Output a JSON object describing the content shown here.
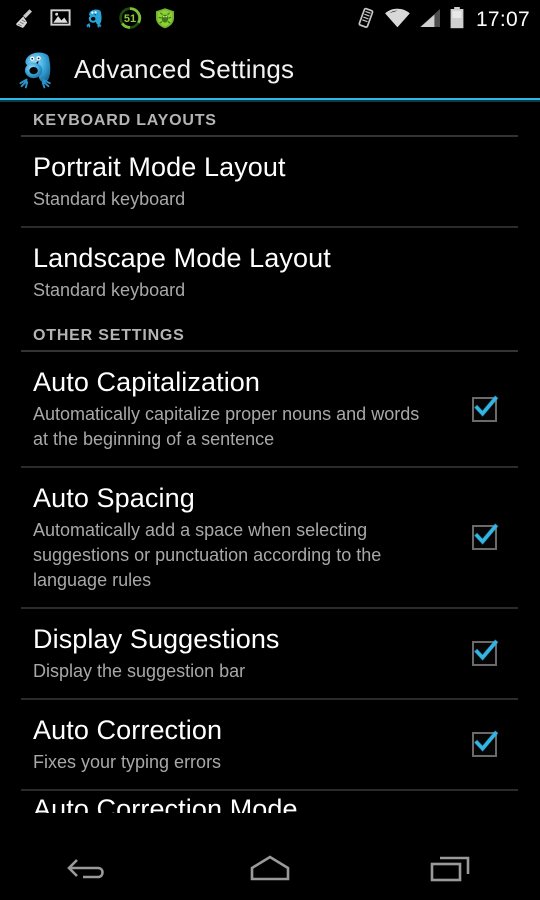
{
  "status_bar": {
    "left_icons": [
      {
        "name": "cleaner-broom-icon",
        "label": "Cleaner"
      },
      {
        "name": "gallery-image-icon",
        "label": "Gallery"
      },
      {
        "name": "adaptxt-keyboard-icon",
        "label": "Adaptxt Keyboard"
      },
      {
        "name": "battery-saver-progress-icon",
        "label": "Battery Saver",
        "value": "51"
      },
      {
        "name": "antivirus-shield-icon",
        "label": "Antivirus"
      }
    ],
    "right_icons": [
      {
        "name": "vibrate-icon",
        "label": "Vibrate"
      },
      {
        "name": "wifi-icon",
        "label": "Wi-Fi"
      },
      {
        "name": "cell-signal-icon",
        "label": "Mobile signal"
      },
      {
        "name": "battery-icon",
        "label": "Battery"
      }
    ],
    "clock": "17:07"
  },
  "action_bar": {
    "icon_name": "adaptxt-app-icon",
    "title": "Advanced Settings",
    "accent_color": "#33b5e5"
  },
  "sections": [
    {
      "header": "KEYBOARD LAYOUTS",
      "items": [
        {
          "name": "portrait-mode-layout",
          "title": "Portrait Mode Layout",
          "summary": "Standard keyboard",
          "has_checkbox": false
        },
        {
          "name": "landscape-mode-layout",
          "title": "Landscape Mode Layout",
          "summary": "Standard keyboard",
          "has_checkbox": false
        }
      ]
    },
    {
      "header": "OTHER SETTINGS",
      "items": [
        {
          "name": "auto-capitalization",
          "title": "Auto Capitalization",
          "summary": "Automatically capitalize proper nouns and words at the beginning of a sentence",
          "has_checkbox": true,
          "checked": true
        },
        {
          "name": "auto-spacing",
          "title": "Auto Spacing",
          "summary": "Automatically add a space when selecting suggestions or punctuation according to the language rules",
          "has_checkbox": true,
          "checked": true
        },
        {
          "name": "display-suggestions",
          "title": "Display Suggestions",
          "summary": "Display the suggestion bar",
          "has_checkbox": true,
          "checked": true
        },
        {
          "name": "auto-correction",
          "title": "Auto Correction",
          "summary": "Fixes your typing errors",
          "has_checkbox": true,
          "checked": true
        },
        {
          "name": "auto-correction-mode",
          "title": "Auto Correction Mode",
          "summary": "",
          "has_checkbox": false,
          "clipped": true
        }
      ]
    }
  ],
  "nav_bar": {
    "buttons": [
      {
        "name": "nav-back-button",
        "label": "Back"
      },
      {
        "name": "nav-home-button",
        "label": "Home"
      },
      {
        "name": "nav-recents-button",
        "label": "Recent apps"
      }
    ]
  },
  "colors": {
    "accent": "#33b5e5",
    "background": "#000000",
    "title_text": "#ffffff",
    "summary_text": "#a8a8a8",
    "header_text": "#b4b4b4",
    "divider": "#333333"
  }
}
